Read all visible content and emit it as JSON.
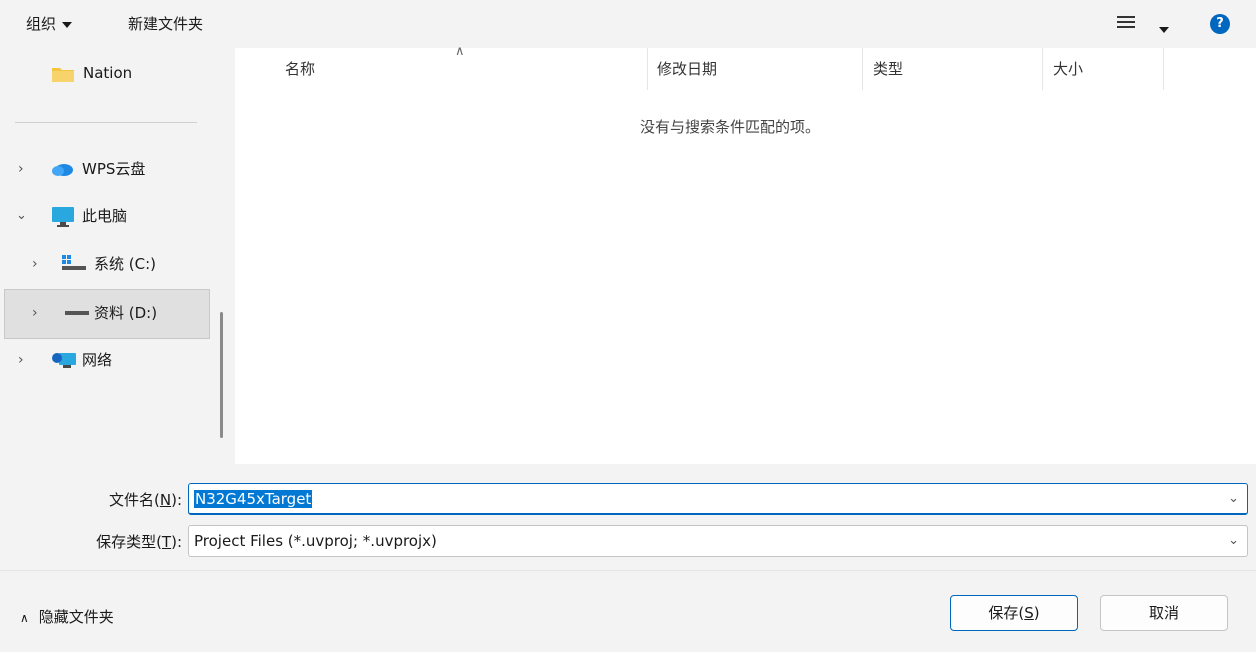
{
  "toolbar": {
    "organize": "组织",
    "new_folder": "新建文件夹"
  },
  "nav": {
    "quick_item": "Nation",
    "items": [
      {
        "label": "WPS云盘"
      },
      {
        "label": "此电脑"
      },
      {
        "label": "系统 (C:)"
      },
      {
        "label": "资料 (D:)"
      },
      {
        "label": "网络"
      }
    ]
  },
  "list": {
    "columns": [
      "名称",
      "修改日期",
      "类型",
      "大小"
    ],
    "empty_message": "没有与搜索条件匹配的项。"
  },
  "form": {
    "filename_label_prefix": "文件名(",
    "filename_label_key": "N",
    "filename_label_suffix": "):",
    "filename_value": "N32G45xTarget",
    "filetype_label_prefix": "保存类型(",
    "filetype_label_key": "T",
    "filetype_label_suffix": "):",
    "filetype_value": "Project Files (*.uvproj; *.uvprojx)"
  },
  "footer": {
    "hide_folders": "隐藏文件夹",
    "save_prefix": "保存(",
    "save_key": "S",
    "save_suffix": ")",
    "cancel": "取消"
  },
  "colors": {
    "accent": "#0067c0",
    "selection": "#0078d4",
    "folder": "#f4c542"
  }
}
